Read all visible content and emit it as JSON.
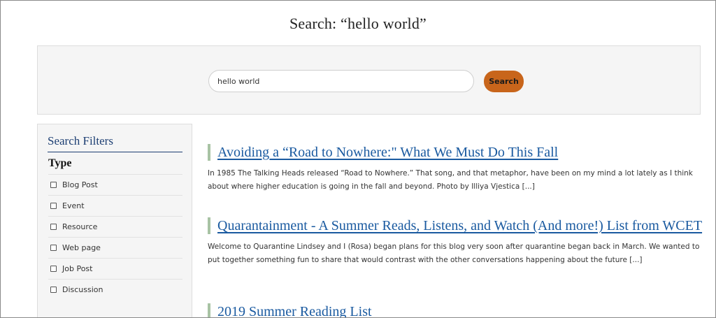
{
  "page": {
    "title": "Search: “hello world”"
  },
  "search": {
    "value": "hello world",
    "button_label": "Search"
  },
  "filters": {
    "title": "Search Filters",
    "type_heading": "Type",
    "items": [
      {
        "label": "Blog Post",
        "checked": false
      },
      {
        "label": "Event",
        "checked": false
      },
      {
        "label": "Resource",
        "checked": false
      },
      {
        "label": "Web page",
        "checked": false
      },
      {
        "label": "Job Post",
        "checked": false
      },
      {
        "label": "Discussion",
        "checked": false
      }
    ]
  },
  "results": [
    {
      "title": "Avoiding a “Road to Nowhere:\" What We Must Do This Fall",
      "excerpt": "In 1985 The Talking Heads released “Road to Nowhere.” That song, and that metaphor, have been on my mind a lot lately as I think about where higher education is going in the fall and beyond. Photo by Illiya Vjestica [...]"
    },
    {
      "title": "Quarantainment - A Summer Reads, Listens, and Watch (And more!) List from WCET",
      "excerpt": "Welcome to Quarantine Lindsey and I (Rosa) began plans for this blog very soon after quarantine began back in March. We wanted to put together something fun to share that would contrast with the other conversations happening about the future [...]"
    },
    {
      "title": "2019 Summer Reading List",
      "excerpt": ""
    }
  ],
  "colors": {
    "accent_button": "#c8651b",
    "link": "#1a5aa0",
    "filter_title": "#1d3f73",
    "result_bar": "#a8c3a4"
  }
}
